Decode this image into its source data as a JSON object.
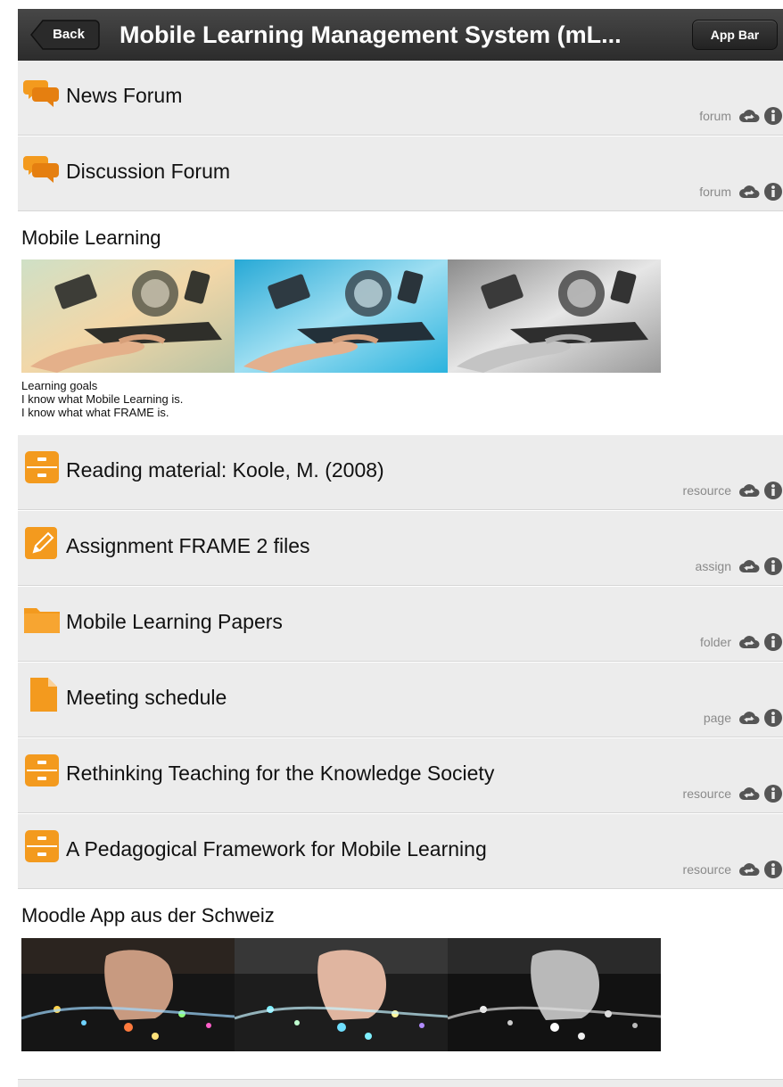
{
  "header": {
    "back_label": "Back",
    "title": "Mobile Learning Management System (mL...",
    "app_bar_label": "App Bar"
  },
  "colors": {
    "header_bg": "#333333",
    "row_bg": "#ececec",
    "icon_orange": "#f39a1e",
    "meta_gray": "#8a8a8a"
  },
  "modules_top": [
    {
      "title": "News Forum",
      "type": "forum",
      "icon": "forum-icon"
    },
    {
      "title": "Discussion Forum",
      "type": "forum",
      "icon": "forum-icon"
    }
  ],
  "label1": {
    "heading": "Mobile Learning",
    "goals": [
      "Learning goals",
      "I know what Mobile Learning is.",
      "I know what what FRAME is."
    ]
  },
  "modules_mid": [
    {
      "title": "Reading material: Koole, M. (2008)",
      "type": "resource",
      "icon": "resource-icon"
    },
    {
      "title": "Assignment FRAME 2 files",
      "type": "assign",
      "icon": "assign-icon"
    },
    {
      "title": "Mobile Learning Papers",
      "type": "folder",
      "icon": "folder-icon"
    },
    {
      "title": "Meeting schedule",
      "type": "page",
      "icon": "page-icon"
    },
    {
      "title": "Rethinking Teaching for the Knowledge Society",
      "type": "resource",
      "icon": "resource-icon"
    },
    {
      "title": "A Pedagogical Framework for Mobile Learning",
      "type": "resource",
      "icon": "resource-icon"
    }
  ],
  "label2": {
    "heading": "Moodle App aus der Schweiz"
  }
}
